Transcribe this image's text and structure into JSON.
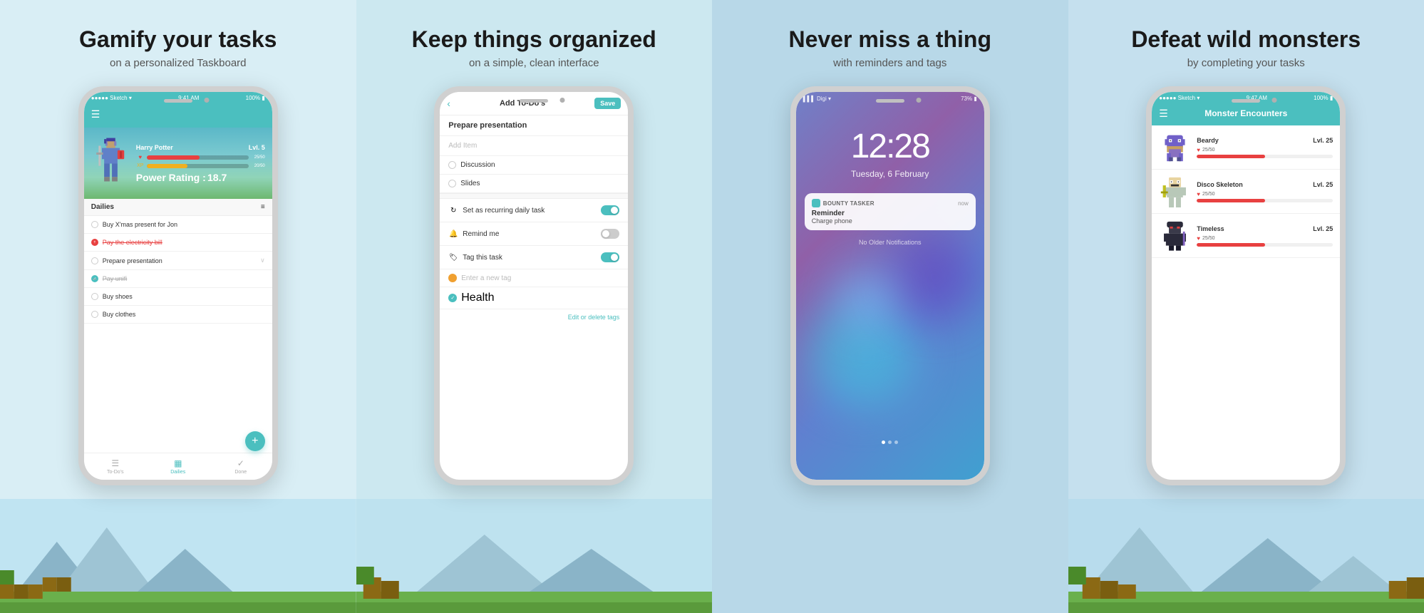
{
  "panels": [
    {
      "id": "panel-1",
      "title": "Gamify your tasks",
      "subtitle": "on a personalized Taskboard",
      "bgClass": "panel-1"
    },
    {
      "id": "panel-2",
      "title": "Keep things organized",
      "subtitle": "on a simple, clean interface",
      "bgClass": "panel-2"
    },
    {
      "id": "panel-3",
      "title": "Never miss a thing",
      "subtitle": "with reminders and tags",
      "bgClass": "panel-3"
    },
    {
      "id": "panel-4",
      "title": "Defeat wild monsters",
      "subtitle": "by completing your tasks",
      "bgClass": "panel-4"
    }
  ],
  "screen1": {
    "status_bar": "●●●●● Sketch  ▾    9:41 AM                      100% ▮",
    "character_name": "Harry Potter",
    "character_level": "Lvl. 5",
    "hp_label": "25/50",
    "xp_label": "20/50",
    "power_label": "Power Rating :",
    "power_value": "18.7",
    "section_title": "Dailies",
    "tasks": [
      {
        "text": "Buy X'mas present for Jon",
        "state": "normal"
      },
      {
        "text": "Pay the electricity bill",
        "state": "overdue"
      },
      {
        "text": "Prepare presentation",
        "state": "normal",
        "hasChevron": true
      },
      {
        "text": "Pay unifi",
        "state": "checked"
      },
      {
        "text": "Buy shoes",
        "state": "normal"
      },
      {
        "text": "Buy clothes",
        "state": "normal"
      }
    ],
    "tabs": [
      {
        "label": "To-Do's",
        "icon": "☰",
        "active": false
      },
      {
        "label": "Dailies",
        "icon": "▦",
        "active": true
      },
      {
        "label": "Done",
        "icon": "✓",
        "active": false
      }
    ]
  },
  "screen2": {
    "title": "Add To-Do's",
    "save_label": "Save",
    "task_title": "Prepare presentation",
    "add_item_placeholder": "Add Item",
    "checklist_items": [
      "Discussion",
      "Slides"
    ],
    "recurring_label": "Set as recurring daily task",
    "remind_label": "Remind me",
    "tag_label": "Tag this task",
    "tag_placeholder": "Enter a new tag",
    "tag_item": "Health",
    "edit_tags_label": "Edit or delete tags"
  },
  "screen3": {
    "status_signal": "▌▌▌ Digi ▾",
    "status_battery": "73% ▮",
    "time": "12:28",
    "date": "Tuesday, 6 February",
    "app_name": "BOUNTY TASKER",
    "notif_time": "now",
    "notif_title": "Reminder",
    "notif_body": "Charge phone",
    "no_older": "No Older Notifications"
  },
  "screen4": {
    "status_bar": "●●●●● Sketch  ▾    9:47 AM                      100% ▮",
    "title": "Monster Encounters",
    "monsters": [
      {
        "name": "Beardy",
        "level": "Lvl. 25",
        "hp": "25/50",
        "hp_pct": 50,
        "color": "#e84040"
      },
      {
        "name": "Disco Skeleton",
        "level": "Lvl. 25",
        "hp": "25/50",
        "hp_pct": 50,
        "color": "#e84040"
      },
      {
        "name": "Timeless",
        "level": "Lvl. 25",
        "hp": "25/50",
        "hp_pct": 50,
        "color": "#e84040"
      }
    ]
  }
}
